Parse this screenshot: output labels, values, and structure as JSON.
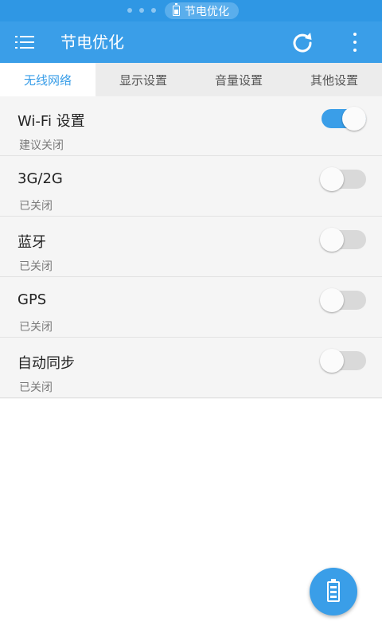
{
  "status_bar": {
    "label": "节电优化",
    "icon": "battery-icon"
  },
  "app_bar": {
    "title": "节电优化",
    "menu_icon": "menu-icon",
    "refresh_icon": "refresh-icon",
    "more_icon": "more-vert-icon",
    "accent": "#3a9ee8"
  },
  "tabs": [
    {
      "label": "无线网络",
      "active": true
    },
    {
      "label": "显示设置",
      "active": false
    },
    {
      "label": "音量设置",
      "active": false
    },
    {
      "label": "其他设置",
      "active": false
    }
  ],
  "settings": [
    {
      "title": "Wi-Fi 设置",
      "status": "建议关闭",
      "enabled": true
    },
    {
      "title": "3G/2G",
      "status": "已关闭",
      "enabled": false
    },
    {
      "title": "蓝牙",
      "status": "已关闭",
      "enabled": false
    },
    {
      "title": "GPS",
      "status": "已关闭",
      "enabled": false
    },
    {
      "title": "自动同步",
      "status": "已关闭",
      "enabled": false
    }
  ],
  "fab": {
    "icon": "battery-icon"
  }
}
